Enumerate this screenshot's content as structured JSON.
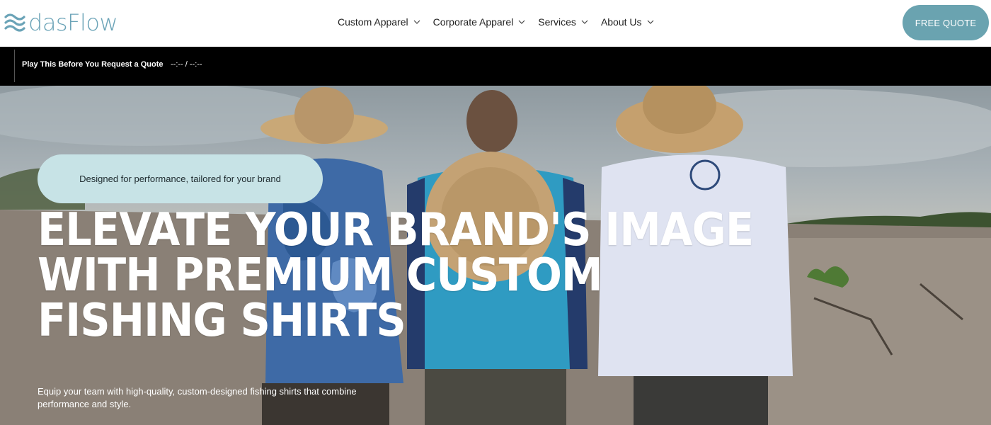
{
  "brand": {
    "logo_text": "dasFlow",
    "accent_color": "#6aa3b7"
  },
  "nav": {
    "items": [
      {
        "label": "Custom Apparel"
      },
      {
        "label": "Corporate Apparel"
      },
      {
        "label": "Services"
      },
      {
        "label": "About Us"
      }
    ],
    "cta_label": "FREE QUOTE",
    "cta_color": "#6aa3b0"
  },
  "audio": {
    "title": "Play This Before You Request a Quote",
    "time": "--:-- / --:--"
  },
  "hero": {
    "tagline": "Designed for performance, tailored for your brand",
    "headline_lines": [
      "ELEVATE YOUR BRAND'S IMAGE",
      "WITH PREMIUM CUSTOM",
      "FISHING SHIRTS"
    ],
    "subtext": "Equip your team with high-quality, custom-designed fishing shirts that combine performance and style.",
    "pill_color": "#c7e3e6"
  },
  "icons": [
    "wave-logo-icon",
    "chevron-down-icon"
  ]
}
